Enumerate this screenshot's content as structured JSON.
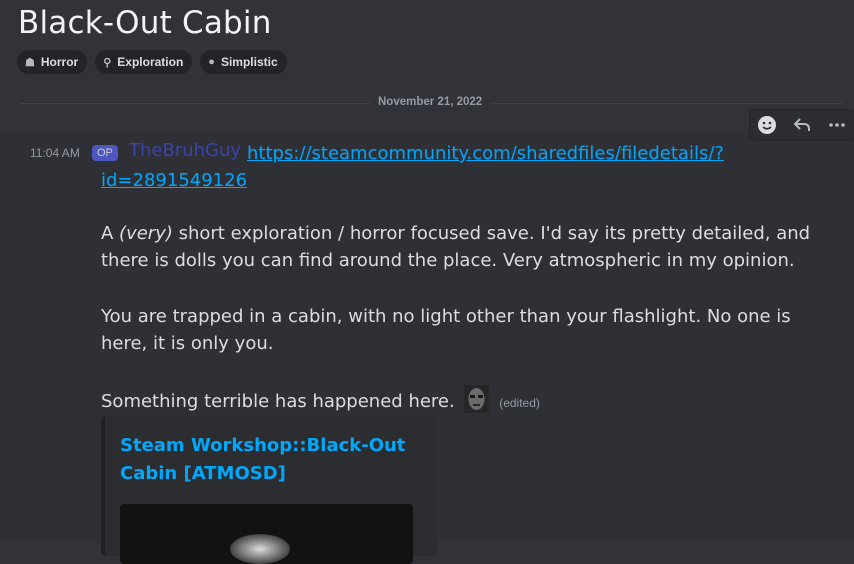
{
  "thread": {
    "title": "Black-Out Cabin",
    "tags": [
      {
        "icon": "mask-icon",
        "label": "Horror"
      },
      {
        "icon": "walking-icon",
        "label": "Exploration"
      },
      {
        "icon": "penguin-icon",
        "label": "Simplistic"
      }
    ]
  },
  "date_divider": "November 21, 2022",
  "message": {
    "timestamp": "11:04 AM",
    "op_badge": "OP",
    "author": "TheBruhGuy",
    "link_line1": "https://steamcommunity.com/sharedfiles/filedetails/?",
    "link_line2": "id=2891549126",
    "para1_a": "A ",
    "para1_em": "(very)",
    "para1_b": " short exploration / horror focused save. I'd say its pretty detailed, and there is dolls you can find around the place. Very atmospheric in my opinion.",
    "para2": "You are trapped in a cabin, with no light other than your flashlight. No one is here, it is only you.",
    "para3": "Something terrible has happened here.",
    "edited": "(edited)",
    "embed_title": "Steam Workshop::Black-Out Cabin [ATMOSD]"
  },
  "actions": [
    "add-reaction-icon",
    "reply-icon",
    "more-icon"
  ],
  "colors": {
    "link": "#00a8fc",
    "background": "#313338",
    "op_badge": "#5865f2"
  }
}
